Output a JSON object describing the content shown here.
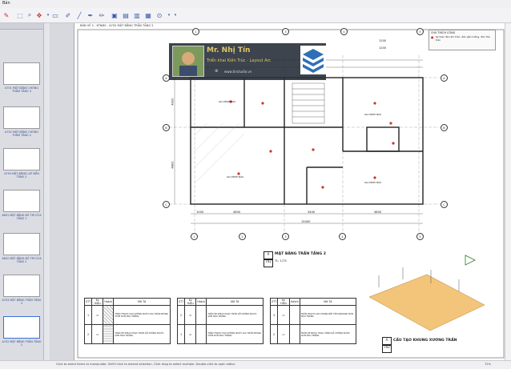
{
  "app": {
    "title": "Bản",
    "tab_label": "BẢN VẼ 2 - KTNĐS - A702 MẶT BẰNG TRẦN TẦNG 2"
  },
  "toolbar": {
    "icons": [
      "pen-icon",
      "select-icon",
      "zoom-icon",
      "pan-icon",
      "brush-icon",
      "line-icon",
      "rect-icon",
      "pencil-icon",
      "stamp-icon",
      "doc-icon",
      "doc2-icon",
      "save-icon",
      "help-icon",
      "dropdown-icon"
    ]
  },
  "sidebar": {
    "items": [
      {
        "label": "A701 MẶT BẰNG CHỐNG THẤM TẦNG 3"
      },
      {
        "label": "A702 MẶT BẰNG CHỐNG THẤM TẦNG 2"
      },
      {
        "label": "A703 MẶT BẰNG LÁT NỀN TẦNG 2"
      },
      {
        "label": "A801 MẶT BẰNG BỐ TRÍ CỬA TẦNG 1"
      },
      {
        "label": "A802 MẶT BẰNG BỐ TRÍ CỬA TẦNG 2"
      },
      {
        "label": "A703 MẶT BẰNG TRẦN TẦNG 3"
      },
      {
        "label": "A702 MẶT BẰNG TRẦN TẦNG 2"
      }
    ]
  },
  "banner": {
    "name": "Mr. Nhị Tín",
    "subtitle": "Triển khai Kiến Trúc - Layout Arc",
    "url": "www.tinstudio.vn"
  },
  "drawing": {
    "dims_top": [
      "1200",
      "1800",
      "3800",
      "1200"
    ],
    "dims_top2": [
      "1200",
      "3500",
      "3500",
      "1200"
    ],
    "dims_bottom": [
      "1000",
      "4800",
      "3400",
      "4800"
    ],
    "dims_bottom_total": "15000",
    "dims_left": [
      "4000",
      "4800"
    ],
    "grid_cols": [
      "1",
      "2",
      "3",
      "4",
      "5"
    ],
    "grid_rows": [
      "A",
      "B",
      "C"
    ],
    "room_tag": "GIA ĐÌNH NÂU",
    "title_block": {
      "id": "A",
      "sheet": "702",
      "title": "MẶT BẰNG TRẦN TẦNG 2",
      "scale": "TL: 1/75"
    },
    "section_block": {
      "id": "A",
      "sheet": "702",
      "title": "CẤU TẠO KHUNG XƯƠNG TRẦN"
    }
  },
  "legend_panel": {
    "title": "CHÚ THÍCH CÔNG",
    "text": "Ký hiệu đèn âm trần, đèn gắn tường, đèn thả trần"
  },
  "tables": {
    "headers": [
      "STT",
      "Ký Hiệu",
      "Hatch",
      "Mô Tả"
    ],
    "rows": [
      [
        "1",
        "",
        "",
        "TRẦN THẠCH CAO CHỐNG NƯỚC GIA TRẦN KHUNG CHÌM SƠN MÀU TRẮNG"
      ],
      [
        "2",
        "",
        "",
        "TRẦN ỐP NHỰA HOẠC TRẦN GỖ CHỐNG NƯỚC SƠN MÀU TRẮNG"
      ],
      [
        "3",
        "",
        "",
        "TRẦN THẠCH CAO KHUNG NỔI TẤM 600X600 SƠN MÀU TRẮNG"
      ]
    ]
  },
  "status": {
    "text": "Click to select items to manipulate. Shift+click to extend selection. Click drag to select multiple. Double-click to open editor.",
    "zoom": "72%"
  }
}
